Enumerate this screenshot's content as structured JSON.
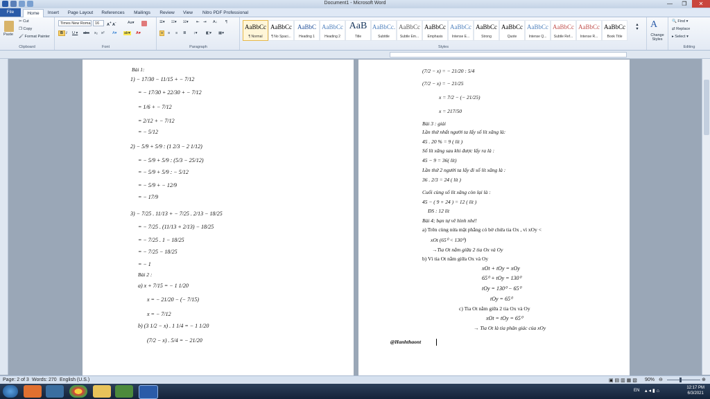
{
  "window": {
    "title": "Document1 - Microsoft Word"
  },
  "tabs": [
    "File",
    "Home",
    "Insert",
    "Page Layout",
    "References",
    "Mailings",
    "Review",
    "View",
    "Nitro PDF Professional"
  ],
  "ribbon": {
    "clipboard": {
      "paste": "Paste",
      "cut": "Cut",
      "copy": "Copy",
      "format_painter": "Format Painter",
      "label": "Clipboard"
    },
    "font": {
      "name": "Times New Roma",
      "size": "16",
      "label": "Font"
    },
    "paragraph": {
      "label": "Paragraph"
    },
    "styles": {
      "label": "Styles",
      "items": [
        {
          "sample": "AaBbCc",
          "name": "¶ Normal"
        },
        {
          "sample": "AaBbCc",
          "name": "¶ No Spaci..."
        },
        {
          "sample": "AaBbC",
          "name": "Heading 1"
        },
        {
          "sample": "AaBbCc",
          "name": "Heading 2"
        },
        {
          "sample": "AaB",
          "name": "Title"
        },
        {
          "sample": "AaBbCc.",
          "name": "Subtitle"
        },
        {
          "sample": "AaBbCc",
          "name": "Subtle Em..."
        },
        {
          "sample": "AaBbCc",
          "name": "Emphasis"
        },
        {
          "sample": "AaBbCc",
          "name": "Intense E..."
        },
        {
          "sample": "AaBbCc",
          "name": "Strong"
        },
        {
          "sample": "AaBbCc",
          "name": "Quote"
        },
        {
          "sample": "AaBbCc",
          "name": "Intense Q..."
        },
        {
          "sample": "AaBbCc",
          "name": "Subtle Ref..."
        },
        {
          "sample": "AaBbCc",
          "name": "Intense R..."
        },
        {
          "sample": "AaBbCc",
          "name": "Book Title"
        }
      ],
      "change_styles": "Change Styles"
    },
    "editing": {
      "find": "Find",
      "replace": "Replace",
      "select": "Select",
      "label": "Editing"
    }
  },
  "left_page": [
    "Bài 1:",
    "1) − 17/30 − 11/15 + − 7/12",
    "= − 17/30 + 22/30 + − 7/12",
    "= 1/6 + − 7/12",
    "= 2/12 + − 7/12",
    "= − 5/12",
    "2) − 5/9 + 5/9 : (1 2/3 − 2 1/12)",
    "= − 5/9 + 5/9 : (5/3 − 25/12)",
    "= − 5/9 + 5/9 : − 5/12",
    "= − 5/9 + − 12/9",
    "= − 17/9",
    "3) − 7/25 . 11/13 + − 7/25 . 2/13 − 18/25",
    "= − 7/25 . (11/13 + 2/13) − 18/25",
    "= − 7/25 . 1 − 18/25",
    "= − 7/25 − 18/25",
    "= − 1",
    "Bài 2 :",
    "a) x + 7/15 = − 1 1/20",
    "x = − 21/20 − (− 7/15)",
    "x = − 7/12",
    "b) (3 1/2 − x) . 1 1/4 = − 1 1/20",
    "(7/2 − x) . 5/4 = − 21/20"
  ],
  "right_page": [
    "(7/2 − x) = − 21/20 : 5/4",
    "(7/2 − x) = − 21/25",
    "x = 7/2 − (− 21/25)",
    "x = 217/50",
    "Bài 3 :       giải",
    "Lần thứ nhất người ta lấy số lít xăng là:",
    "45 . 20 % = 9 ( lít )",
    "Số lít xăng sau khi được lấy ra là :",
    "45 − 9 = 36( lít)",
    "Lần thứ 2 người ta lấy đi số lít xăng là :",
    "36 . 2/3 = 24 ( lít )",
    "Cuối cùng số lít xăng còn lại là :",
    "45 − ( 9 + 24 ) = 12 ( lít )",
    "ĐS : 12 lít",
    "Bài 4; bạn tự vẽ hình nhé!",
    "a) Trên cùng nửa mặt phẳng có bờ chứa tia Ox , vì xOy <",
    "xOt (65⁰ < 130⁰)",
    "→Tia Ot nằm giữa 2 tia Ox và Oy",
    "b) Vì tia Ot nằm giữa Ox và Oy",
    "xOt + tOy = xOy",
    "65⁰ + tOy = 130⁰",
    "tOy = 130⁰ − 65⁰",
    "tOy = 65⁰",
    "c)   Tia Ot nằm giữa 2 tia Ox và Oy",
    "xOt = tOy = 65⁰",
    "→ Tia Ot là tia phân giác của xOy",
    "@Hanhthaont"
  ],
  "status": {
    "page": "Page: 2 of 3",
    "words": "Words: 270",
    "language": "English (U.S.)",
    "zoom": "90%"
  },
  "taskbar": {
    "lang": "EN",
    "time": "12:17 PM",
    "date": "6/3/2021"
  }
}
